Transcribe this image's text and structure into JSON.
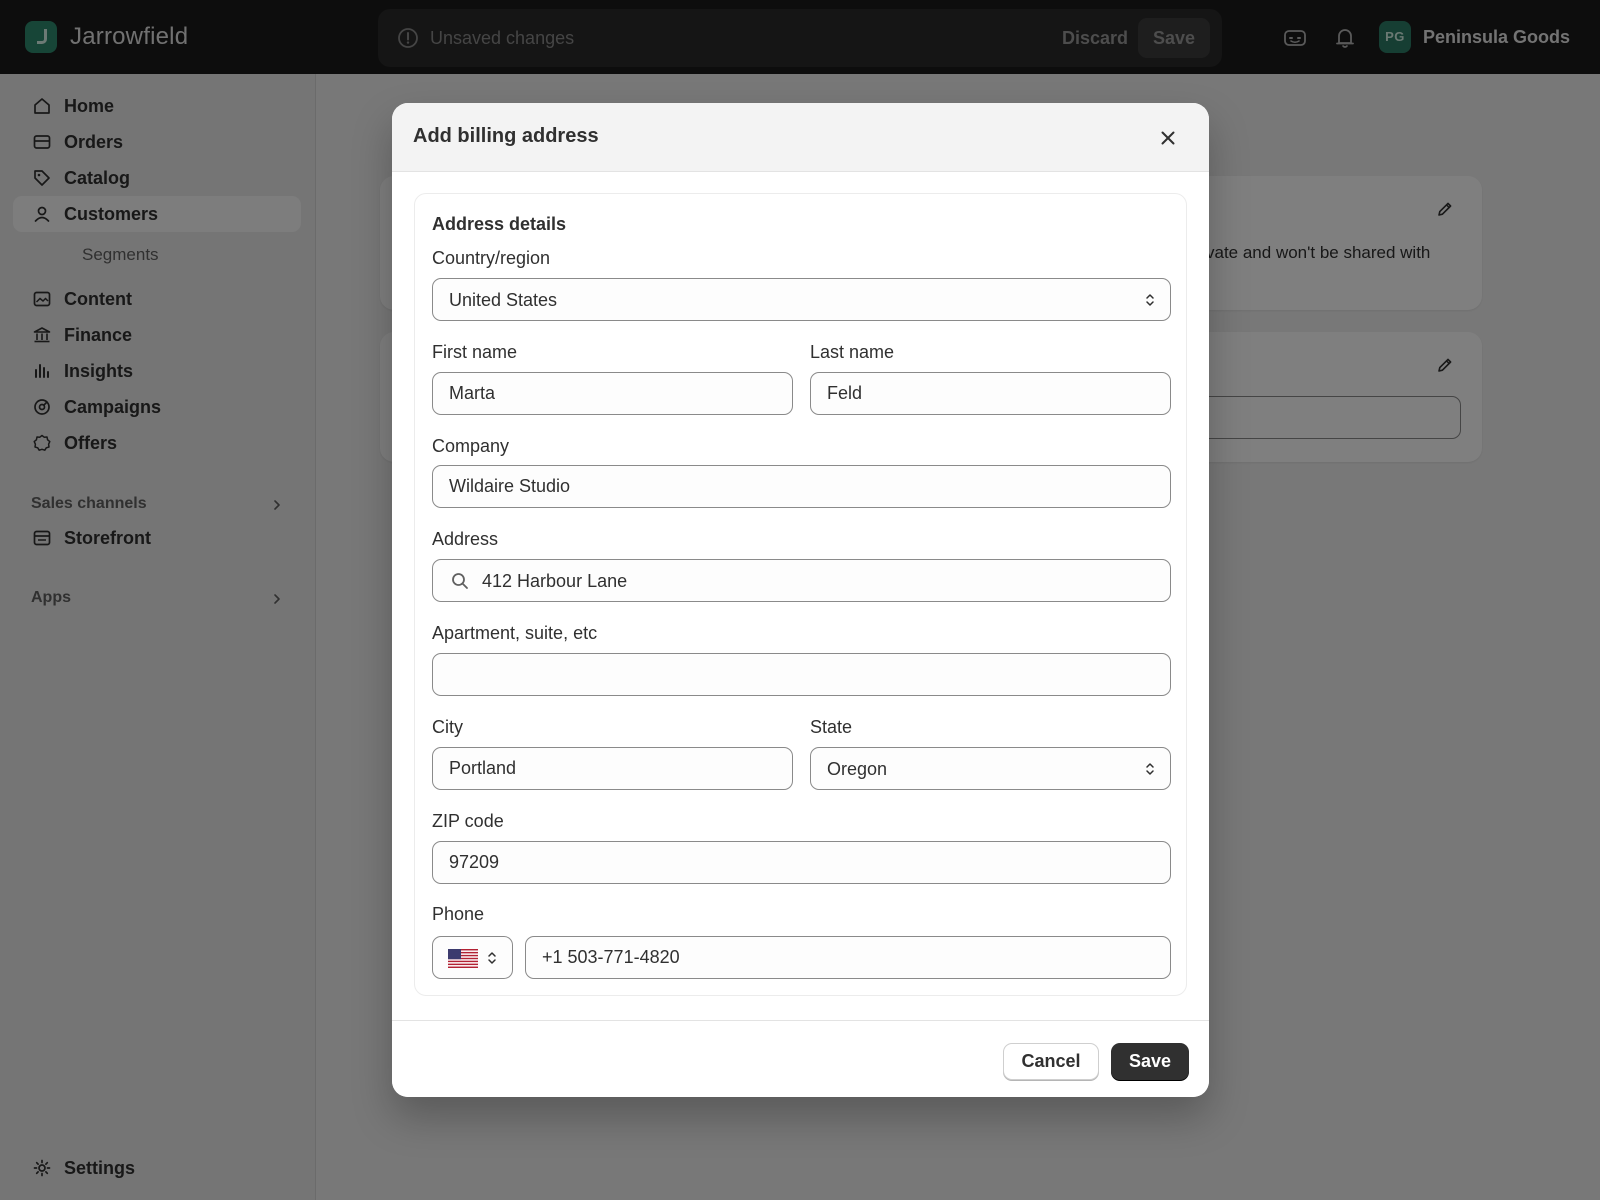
{
  "app": {
    "brand": "Jarrowfield",
    "store_initials": "PG",
    "store_name": "Peninsula Goods"
  },
  "savebar": {
    "message": "Unsaved changes",
    "discard_label": "Discard",
    "save_label": "Save"
  },
  "sidebar": {
    "items": [
      {
        "label": "Home",
        "icon": "home-icon"
      },
      {
        "label": "Orders",
        "icon": "orders-icon"
      },
      {
        "label": "Catalog",
        "icon": "tag-icon"
      },
      {
        "label": "Customers",
        "icon": "person-icon",
        "active": true
      },
      {
        "label": "Content",
        "icon": "image-icon"
      },
      {
        "label": "Finance",
        "icon": "bank-icon"
      },
      {
        "label": "Insights",
        "icon": "bar-chart-icon"
      },
      {
        "label": "Campaigns",
        "icon": "target-icon"
      },
      {
        "label": "Offers",
        "icon": "badge-icon"
      }
    ],
    "sub_item": "Segments",
    "sales_channels_label": "Sales channels",
    "storefront_label": "Storefront",
    "apps_label": "Apps",
    "settings_label": "Settings"
  },
  "background": {
    "partial_text": "vate and won't be shared with"
  },
  "modal": {
    "title": "Add billing address",
    "section_title": "Address details",
    "fields": {
      "country_label": "Country/region",
      "country_value": "United States",
      "first_name_label": "First name",
      "first_name_value": "Marta",
      "last_name_label": "Last name",
      "last_name_value": "Feld",
      "company_label": "Company",
      "company_value": "Wildaire Studio",
      "address_label": "Address",
      "address_value": "412 Harbour Lane",
      "apartment_label": "Apartment, suite, etc",
      "apartment_value": "",
      "city_label": "City",
      "city_value": "Portland",
      "state_label": "State",
      "state_value": "Oregon",
      "zip_label": "ZIP code",
      "zip_value": "97209",
      "phone_label": "Phone",
      "phone_value": "+1 503-771-4820",
      "phone_country_flag": "us-flag-icon"
    },
    "cancel_label": "Cancel",
    "save_label": "Save"
  },
  "colors": {
    "topbar": "#1a1a1a",
    "brand_accent": "#2f8a6f",
    "primary_button": "#303030"
  }
}
